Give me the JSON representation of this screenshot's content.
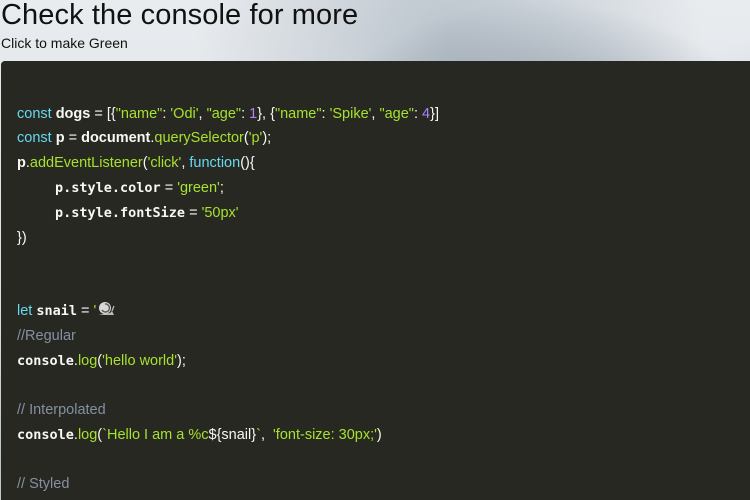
{
  "header": {
    "title": "Check the console for more",
    "click_text": "Click to make Green"
  },
  "code": {
    "l1": {
      "kw": "const",
      "var": "dogs",
      "eq": " = ",
      "open": "[{",
      "k1": "\"name\"",
      "c1": ": ",
      "v1": "'Odi'",
      "s1": ", ",
      "k2": "\"age\"",
      "c2": ": ",
      "n1": "1",
      "m1": "}, {",
      "k3": "\"name\"",
      "c3": ": ",
      "v2": "'Spike'",
      "s2": ", ",
      "k4": "\"age\"",
      "c4": ": ",
      "n2": "4",
      "close": "}]"
    },
    "l2": {
      "kw": "const",
      "var": "p",
      "eq": " = ",
      "obj": "document",
      "dot": ".",
      "fn": "querySelector",
      "lp": "(",
      "arg": "'p'",
      "rp": ");"
    },
    "l3": {
      "var": "p",
      "dot": ".",
      "fn": "addEventListener",
      "lp": "(",
      "arg": "'click'",
      "sep": ", ",
      "kw": "function",
      "rest": "(){"
    },
    "l4": {
      "var": "p.style.color",
      "eq": " = ",
      "str": "'green'",
      "end": ";"
    },
    "l5": {
      "var": "p.style.fontSize",
      "eq": " = ",
      "str": "'50px'"
    },
    "l6": {
      "text": "})"
    },
    "l7": {
      "kw": "let",
      "var": "snail",
      "eq": " = ",
      "str": "'"
    },
    "l8": {
      "text": "//Regular"
    },
    "l9": {
      "obj": "console",
      "dot": ".",
      "fn": "log",
      "lp": "(",
      "str": "'hello world'",
      "rp": ");"
    },
    "l10": {
      "text": "// Interpolated"
    },
    "l11": {
      "obj": "console",
      "dot": ".",
      "fn": "log",
      "lp": "(",
      "tpl1": "`Hello I am a %c",
      "tpl2": "${snail}",
      "tpl3": "`",
      "sep": ",  ",
      "str": "'font-size: 30px;'",
      "rp": ")"
    },
    "l12": {
      "text": "// Styled"
    }
  },
  "icons": {
    "snail": "snail-icon"
  }
}
